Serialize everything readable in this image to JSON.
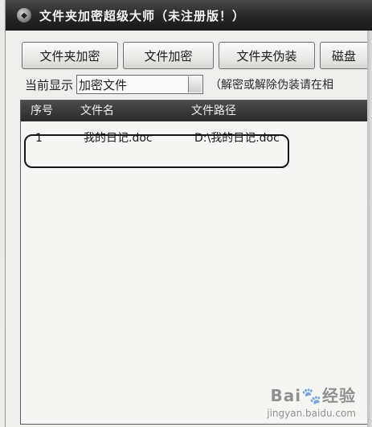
{
  "window": {
    "title": "文件夹加密超级大师（未注册版！）"
  },
  "toolbar": {
    "buttons": [
      "文件夹加密",
      "文件加密",
      "文件夹伪装",
      "磁盘"
    ]
  },
  "filter": {
    "label": "当前显示",
    "selected": "加密文件",
    "hint": "（解密或解除伪装请在相"
  },
  "list": {
    "columns": [
      "序号",
      "文件名",
      "文件路径"
    ],
    "rows": [
      {
        "seq": "1",
        "name": "我的日记.doc",
        "path": "D:\\我的日记.doc"
      }
    ]
  },
  "watermark": {
    "logo": "Bai🐾经验",
    "url": "jingyan.baidu.com"
  }
}
